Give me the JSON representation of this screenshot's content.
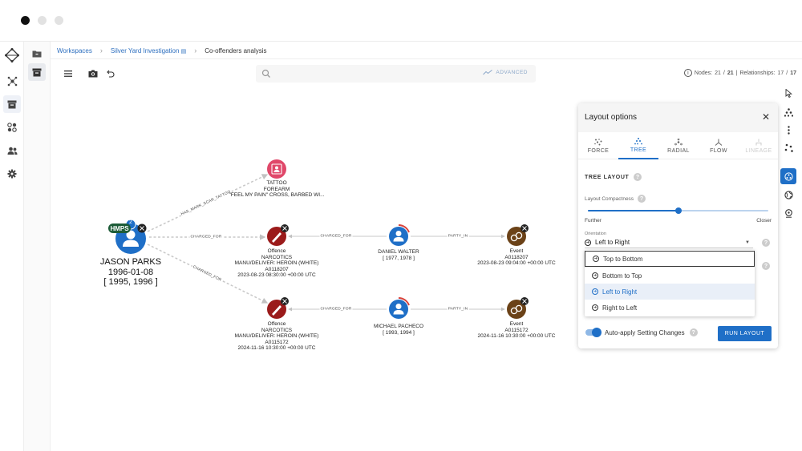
{
  "breadcrumb": {
    "items": [
      "Workspaces",
      "Silver Yard Investigation",
      "Co-offenders analysis"
    ]
  },
  "toolbar": {
    "search_placeholder": "",
    "advanced_label": "ADVANCED",
    "nodes_label": "Nodes:",
    "nodes_visible": "21",
    "nodes_total": "21",
    "relationships_label": "Relationships:",
    "relationships_visible": "17",
    "relationships_total": "17"
  },
  "graph": {
    "root": {
      "name": "JASON PARKS",
      "dob": "1996-01-08",
      "range": "[ 1995, 1996 ]",
      "badge": "HMPS",
      "count": "2"
    },
    "tattoo": {
      "lines": [
        "TATTOO",
        "FOREARM",
        "\"FEEL MY PAIN\" CROSS, BARBED WI..."
      ]
    },
    "offence1": {
      "lines": [
        "Offence",
        "NARCOTICS",
        "MANU/DELIVER: HEROIN (WHITE)",
        "A0118207",
        "2023-08-23 08:30:00 +00:00 UTC"
      ]
    },
    "offence2": {
      "lines": [
        "Offence",
        "NARCOTICS",
        "MANU/DELIVER: HEROIN (WHITE)",
        "A0115172",
        "2024-11-16 10:30:00 +00:00 UTC"
      ]
    },
    "person1": {
      "lines": [
        "DANIEL WALTER",
        "[ 1977, 1978 ]"
      ]
    },
    "person2": {
      "lines": [
        "MICHAEL PACHECO",
        "[ 1993, 1994 ]"
      ]
    },
    "event1": {
      "lines": [
        "Event",
        "A0118207",
        "2023-08-23 09:04:00 +00:00 UTC"
      ]
    },
    "event2": {
      "lines": [
        "Event",
        "A0115172",
        "2024-11-16 10:30:00 +00:00 UTC"
      ]
    },
    "edges": {
      "tattoo": "HAS_MARK_SCAR_TATTOO",
      "charged1": "CHARGED_FOR",
      "charged2": "CHARGED_FOR",
      "charged3": "CHARGED_FOR",
      "charged4": "CHARGED_FOR",
      "party1": "PARTY_IN",
      "party2": "PARTY_IN"
    },
    "colors": {
      "person": "#1f6fc7",
      "offence": "#9b1b1b",
      "tattoo": "#e0486a",
      "event": "#6b4218"
    }
  },
  "panel": {
    "title": "Layout options",
    "tabs": [
      {
        "label": "FORCE"
      },
      {
        "label": "TREE"
      },
      {
        "label": "RADIAL"
      },
      {
        "label": "FLOW"
      },
      {
        "label": "LINEAGE"
      }
    ],
    "section_title": "TREE LAYOUT",
    "compactness_label": "Layout Compactness",
    "compactness_value": 0.5,
    "further_label": "Further",
    "closer_label": "Closer",
    "orientation_label": "Orientation",
    "orientation_value": "Left to Right",
    "orientation_options": [
      "Top to Bottom",
      "Bottom to Top",
      "Left to Right",
      "Right to Left"
    ],
    "auto_apply_label": "Auto-apply Setting Changes",
    "run_label": "RUN LAYOUT"
  }
}
